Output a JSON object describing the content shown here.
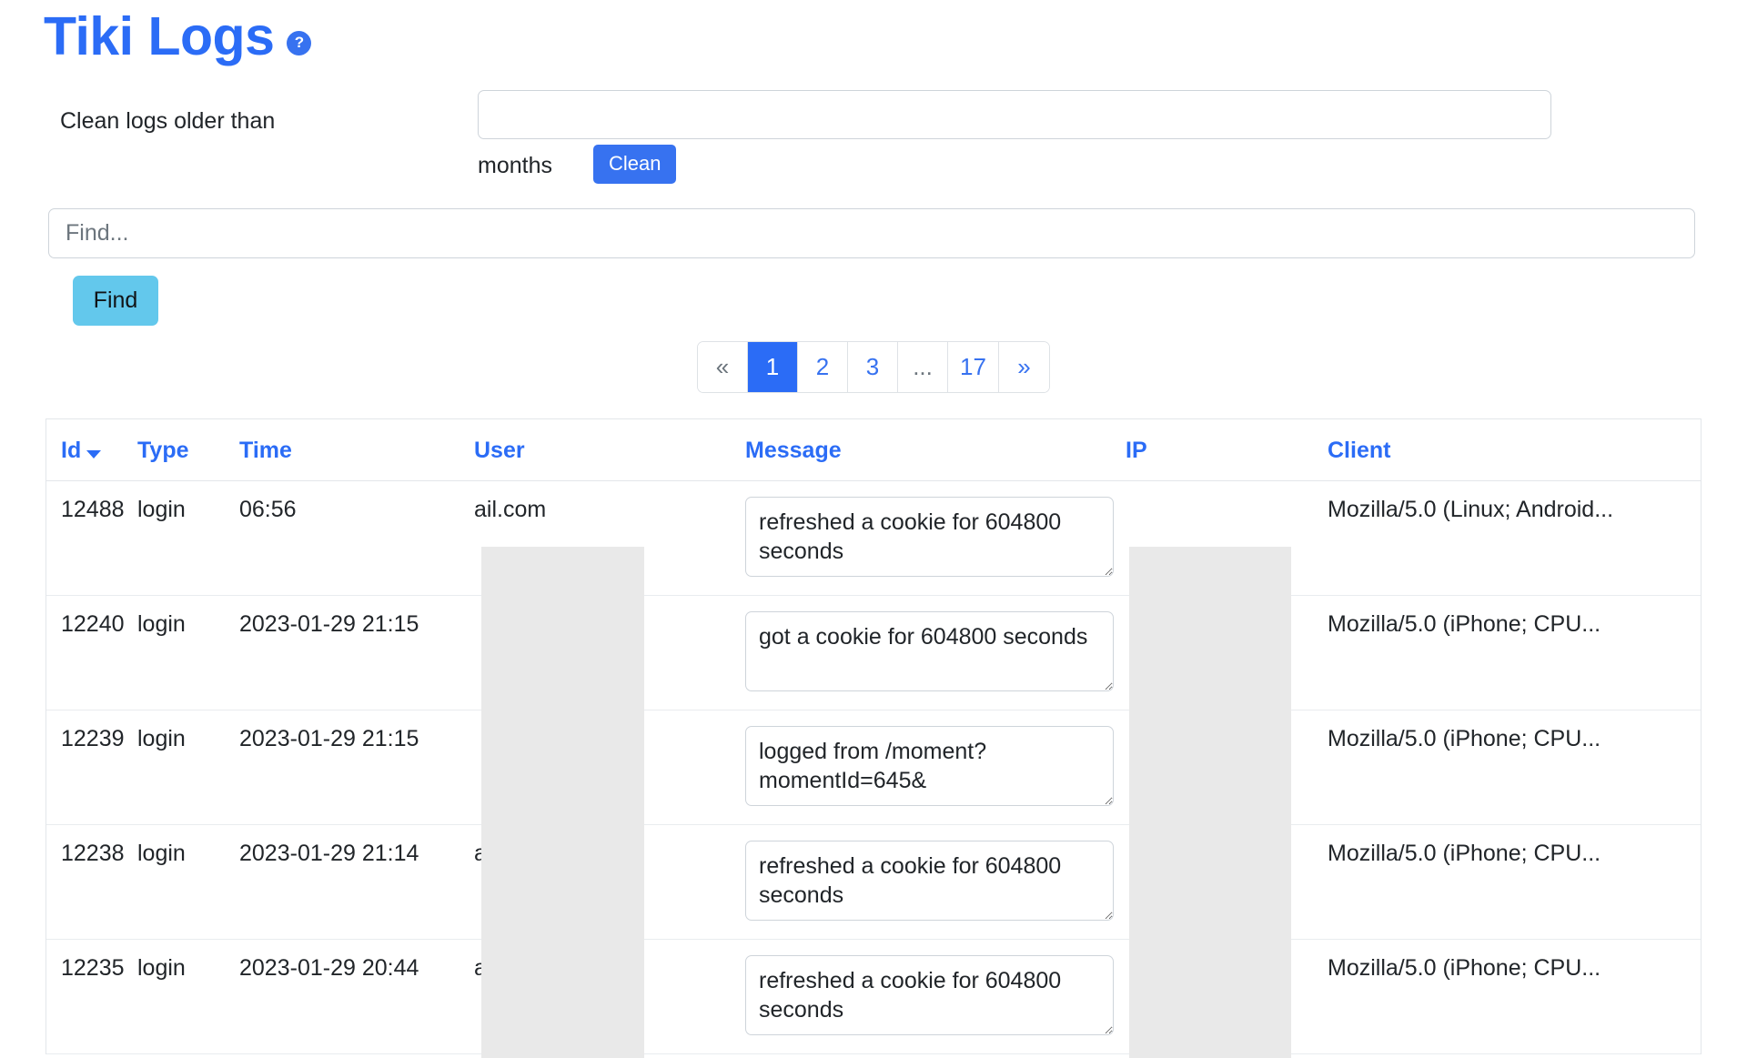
{
  "header": {
    "title": "Tiki Logs",
    "help_icon_label": "?"
  },
  "clean_form": {
    "label": "Clean logs older than",
    "input_value": "",
    "input_placeholder": "",
    "unit_label": "months",
    "button_label": "Clean"
  },
  "find_form": {
    "input_value": "",
    "input_placeholder": "Find...",
    "button_label": "Find"
  },
  "pagination": {
    "prev_label": "«",
    "next_label": "»",
    "ellipsis_label": "...",
    "pages": [
      "1",
      "2",
      "3",
      "17"
    ],
    "active_page": "1"
  },
  "table": {
    "columns": [
      {
        "key": "id",
        "label": "Id",
        "sorted": true,
        "sort_direction": "desc"
      },
      {
        "key": "type",
        "label": "Type",
        "sorted": false
      },
      {
        "key": "time",
        "label": "Time",
        "sorted": false
      },
      {
        "key": "user",
        "label": "User",
        "sorted": false
      },
      {
        "key": "message",
        "label": "Message",
        "sorted": false
      },
      {
        "key": "ip",
        "label": "IP",
        "sorted": false
      },
      {
        "key": "client",
        "label": "Client",
        "sorted": false
      }
    ],
    "rows": [
      {
        "id": "12488",
        "type": "login",
        "time": "06:56",
        "user": "ail.com",
        "message": "refreshed a cookie for 604800 seconds",
        "ip": "",
        "client": "Mozilla/5.0 (Linux; Android..."
      },
      {
        "id": "12240",
        "type": "login",
        "time": "2023-01-29 21:15",
        "user": "",
        "message": "got a cookie for 604800 seconds",
        "ip": "",
        "client": "Mozilla/5.0 (iPhone; CPU..."
      },
      {
        "id": "12239",
        "type": "login",
        "time": "2023-01-29 21:15",
        "user": "",
        "message": "logged from /moment?momentId=645&",
        "ip": "",
        "client": "Mozilla/5.0 (iPhone; CPU..."
      },
      {
        "id": "12238",
        "type": "login",
        "time": "2023-01-29 21:14",
        "user": "ail.com",
        "message": "refreshed a cookie for 604800 seconds",
        "ip": "",
        "client": "Mozilla/5.0 (iPhone; CPU..."
      },
      {
        "id": "12235",
        "type": "login",
        "time": "2023-01-29 20:44",
        "user": "ail.com",
        "message": "refreshed a cookie for 604800 seconds",
        "ip": "",
        "client": "Mozilla/5.0 (iPhone; CPU..."
      }
    ]
  },
  "colors": {
    "brand_blue": "#2b6cf6",
    "button_blue": "#3772f0",
    "find_button": "#63c8ec",
    "redaction_gray": "#e9e9e9",
    "border": "#ced4da"
  }
}
